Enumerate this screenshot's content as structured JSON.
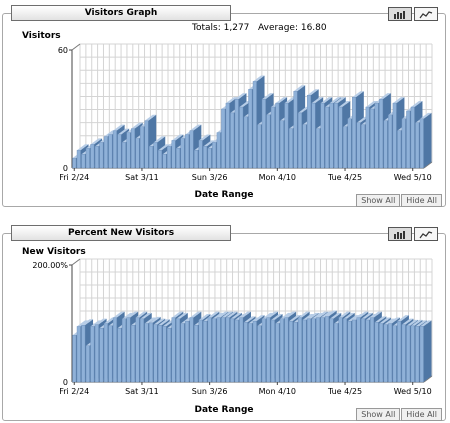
{
  "visitors_panel": {
    "title": "Visitors Graph",
    "totals_label": "Totals:",
    "totals_value": "1,277",
    "average_label": "Average:",
    "average_value": "16.80",
    "show_all": "Show All",
    "hide_all": "Hide All"
  },
  "new_visitors_panel": {
    "title": "Percent New Visitors",
    "show_all": "Show All",
    "hide_all": "Hide All"
  },
  "colors": {
    "bar_front": "#8fb1d8",
    "bar_side": "#4f77a5",
    "bar_top": "#b7cde7",
    "grid": "#d4d4d4"
  },
  "chart_data": [
    {
      "type": "bar",
      "title": "",
      "ylabel": "Visitors",
      "xlabel": "Date Range",
      "ylim": [
        0,
        60
      ],
      "yticks": [
        "0",
        "60"
      ],
      "grid": true,
      "x_tick_labels": [
        "Fri 2/24",
        "Sat 3/11",
        "Sun 3/26",
        "Mon 4/10",
        "Tue 4/25",
        "Wed 5/10"
      ],
      "x_tick_positions": [
        0,
        15,
        30,
        45,
        60,
        75
      ],
      "series": [
        {
          "values": [
            5,
            9,
            7,
            10,
            12,
            11,
            13,
            16,
            17,
            19,
            17,
            13,
            18,
            20,
            15,
            21,
            24,
            11,
            13,
            9,
            7,
            11,
            14,
            10,
            15,
            17,
            19,
            9,
            14,
            11,
            10,
            13,
            18,
            30,
            33,
            28,
            35,
            31,
            26,
            40,
            44,
            22,
            35,
            27,
            31,
            33,
            24,
            33,
            20,
            39,
            28,
            22,
            37,
            33,
            20,
            33,
            31,
            33,
            33,
            31,
            21,
            25,
            36,
            23,
            22,
            31,
            30,
            33,
            35,
            24,
            27,
            33,
            19,
            25,
            29,
            31,
            23,
            25
          ]
        }
      ]
    },
    {
      "type": "bar",
      "title": "",
      "ylabel": "New Visitors",
      "xlabel": "Date Range",
      "ylim": [
        0,
        200
      ],
      "yticks": [
        "0",
        "200.00%"
      ],
      "grid": true,
      "x_tick_labels": [
        "Fri 2/24",
        "Sat 3/11",
        "Sun 3/26",
        "Mon 4/10",
        "Tue 4/25",
        "Wed 5/10"
      ],
      "x_tick_positions": [
        0,
        15,
        30,
        45,
        60,
        75
      ],
      "series": [
        {
          "values": [
            80,
            95,
            97,
            62,
            95,
            98,
            92,
            100,
            96,
            110,
            92,
            108,
            110,
            97,
            110,
            108,
            100,
            101,
            98,
            97,
            95,
            92,
            110,
            108,
            100,
            104,
            110,
            97,
            106,
            104,
            110,
            108,
            110,
            110,
            110,
            108,
            106,
            110,
            102,
            100,
            104,
            96,
            108,
            110,
            106,
            100,
            108,
            110,
            104,
            102,
            110,
            106,
            108,
            108,
            110,
            110,
            112,
            108,
            100,
            110,
            108,
            104,
            106,
            110,
            108,
            106,
            110,
            102,
            100,
            98,
            100,
            96,
            104,
            98,
            96,
            96,
            95,
            95
          ]
        }
      ]
    }
  ]
}
